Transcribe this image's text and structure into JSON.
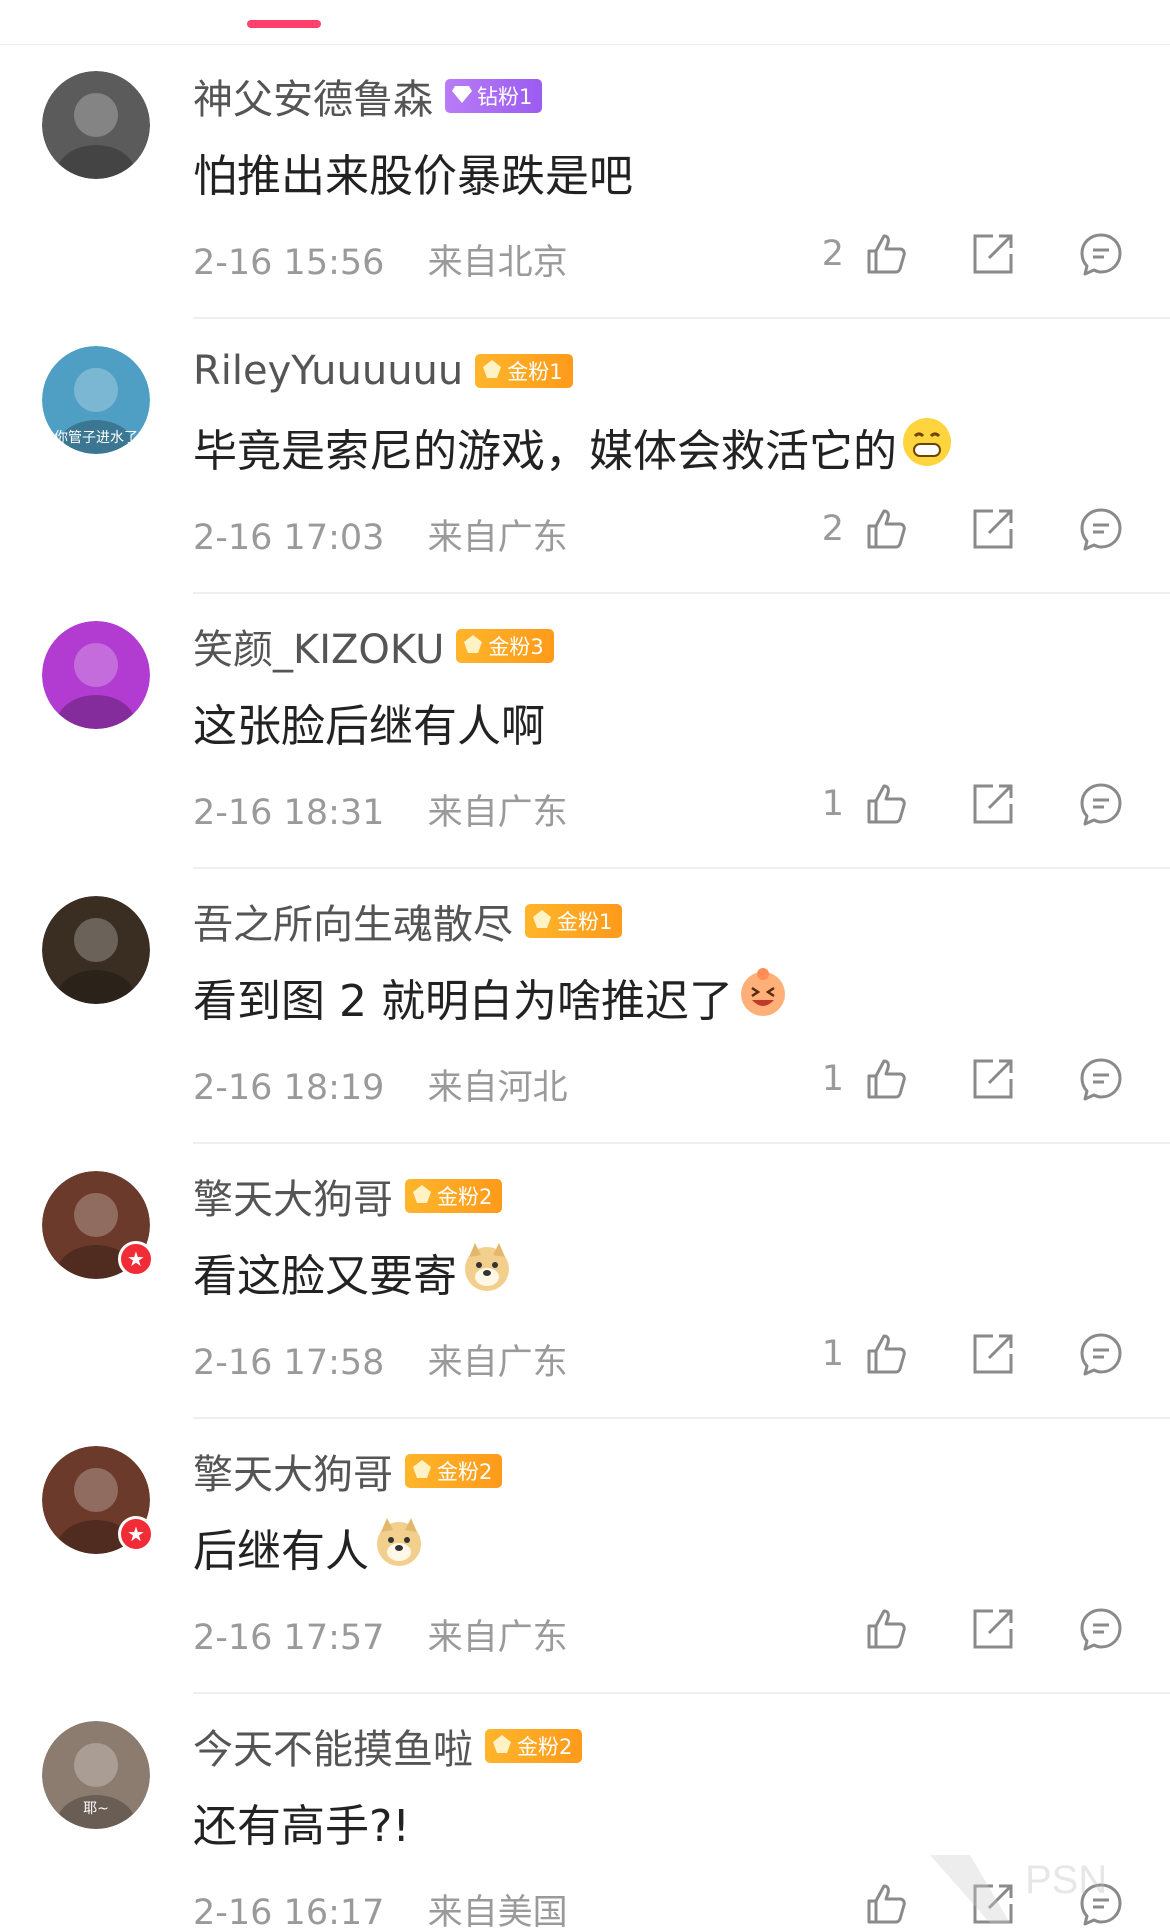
{
  "comments": [
    {
      "user": "神父安德鲁森",
      "badge": "钻粉1",
      "badge_type": "diamond",
      "text": "怕推出来股价暴跌是吧",
      "emoji": "",
      "time": "2-16 15:56",
      "location": "来自北京",
      "likes": "2",
      "avatar_color": "#5b5b5b",
      "vip": false
    },
    {
      "user": "RileyYuuuuuu",
      "badge": "金粉1",
      "badge_type": "gold",
      "text": "毕竟是索尼的游戏，媒体会救活它的",
      "emoji": "grin-emoji",
      "time": "2-16 17:03",
      "location": "来自广东",
      "likes": "2",
      "avatar_color": "#4f9fc4",
      "vip": false
    },
    {
      "user": "笑颜_KIZOKU",
      "badge": "金粉3",
      "badge_type": "gold",
      "text": "这张脸后继有人啊",
      "emoji": "",
      "time": "2-16 18:31",
      "location": "来自广东",
      "likes": "1",
      "avatar_color": "#b23bd1",
      "vip": false
    },
    {
      "user": "吾之所向生魂散尽",
      "badge": "金粉1",
      "badge_type": "gold",
      "text": "看到图 2 就明白为啥推迟了",
      "emoji": "laugh-emoji",
      "time": "2-16 18:19",
      "location": "来自河北",
      "likes": "1",
      "avatar_color": "#3a2e22",
      "vip": false
    },
    {
      "user": "擎天大狗哥",
      "badge": "金粉2",
      "badge_type": "gold",
      "text": "看这脸又要寄",
      "emoji": "doge-emoji",
      "time": "2-16 17:58",
      "location": "来自广东",
      "likes": "1",
      "avatar_color": "#6b3a2a",
      "vip": true
    },
    {
      "user": "擎天大狗哥",
      "badge": "金粉2",
      "badge_type": "gold",
      "text": "后继有人",
      "emoji": "doge-emoji",
      "time": "2-16 17:57",
      "location": "来自广东",
      "likes": "",
      "avatar_color": "#6b3a2a",
      "vip": true
    },
    {
      "user": "今天不能摸鱼啦",
      "badge": "金粉2",
      "badge_type": "gold",
      "text": "还有高手?!",
      "emoji": "",
      "time": "2-16 16:17",
      "location": "来自美国",
      "likes": "",
      "avatar_color": "#8c7c70",
      "vip": false
    }
  ],
  "avatar_captions": {
    "c1": "你管子进水了",
    "c6": "耶~"
  },
  "watermark": "PSN"
}
